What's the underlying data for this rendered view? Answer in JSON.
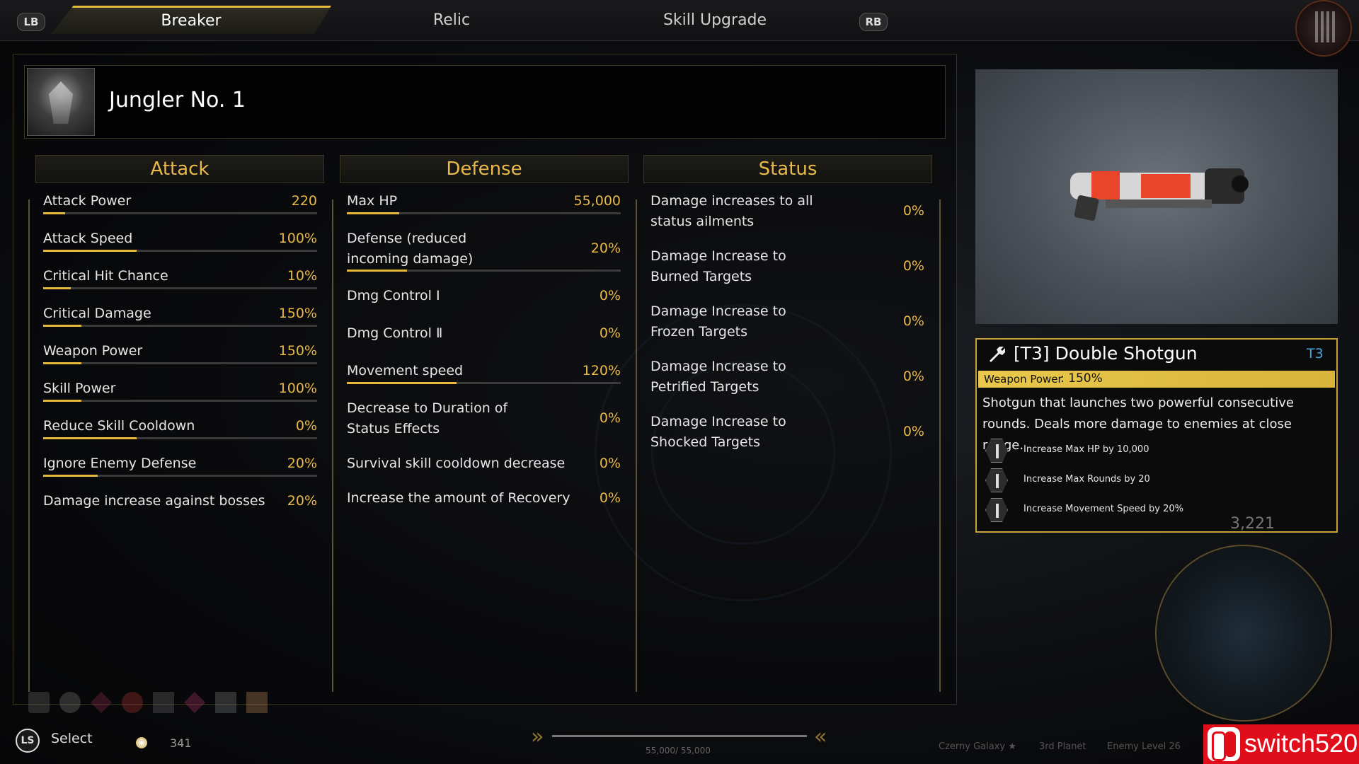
{
  "topbar": {
    "lb": "LB",
    "rb": "RB",
    "tabs": [
      {
        "label": "Breaker"
      },
      {
        "label": "Relic"
      },
      {
        "label": "Skill Upgrade"
      }
    ]
  },
  "character": {
    "name": "Jungler No. 1"
  },
  "columns": {
    "attack": {
      "title": "Attack",
      "stats": [
        {
          "label": "Attack Power",
          "value": "220",
          "bar": 0.08
        },
        {
          "label": "Attack Speed",
          "value": "100%",
          "bar": 0.34
        },
        {
          "label": "Critical Hit Chance",
          "value": "10%",
          "bar": 0.1
        },
        {
          "label": "Critical Damage",
          "value": "150%",
          "bar": 0.14
        },
        {
          "label": "Weapon Power",
          "value": "150%",
          "bar": 0.14
        },
        {
          "label": "Skill Power",
          "value": "100%",
          "bar": 0.14
        },
        {
          "label": "Reduce Skill Cooldown",
          "value": "0%",
          "bar": 0.34
        },
        {
          "label": "Ignore Enemy Defense",
          "value": "20%",
          "bar": 0.2
        },
        {
          "label": "Damage increase against bosses",
          "value": "20%",
          "bar": 0
        }
      ]
    },
    "defense": {
      "title": "Defense",
      "stats": [
        {
          "label": "Max HP",
          "value": "55,000",
          "bar": 0.19
        },
        {
          "label": "Defense (reduced incoming damage)",
          "value": "20%",
          "bar": 0.22
        },
        {
          "label": "Dmg Control Ⅰ",
          "value": "0%",
          "bar": 0
        },
        {
          "label": "Dmg Control Ⅱ",
          "value": "0%",
          "bar": 0
        },
        {
          "label": "Movement speed",
          "value": "120%",
          "bar": 0.4
        },
        {
          "label": "Decrease to Duration of Status Effects",
          "value": "0%",
          "bar": 0
        },
        {
          "label": "Survival skill cooldown decrease",
          "value": "0%",
          "bar": 0
        },
        {
          "label": "Increase the amount of Recovery",
          "value": "0%",
          "bar": 0
        }
      ]
    },
    "status": {
      "title": "Status",
      "stats": [
        {
          "label": "Damage increases to all status ailments",
          "value": "0%"
        },
        {
          "label": "Damage Increase to Burned Targets",
          "value": "0%"
        },
        {
          "label": "Damage Increase to Frozen Targets",
          "value": "0%"
        },
        {
          "label": "Damage Increase to Petrified Targets",
          "value": "0%"
        },
        {
          "label": "Damage Increase to Shocked Targets",
          "value": "0%"
        }
      ]
    }
  },
  "weapon": {
    "title": "[T3] Double Shotgun",
    "tier": "T3",
    "banner_label": "Weapon Power",
    "banner_value": ": 150%",
    "description": "Shotgun that launches two powerful consecutive rounds. Deals more damage to enemies at close range.",
    "perks": [
      "Increase Max HP by 10,000",
      "Increase Max Rounds by 20",
      "Increase Movement Speed by 20%"
    ],
    "colors": {
      "accent": "#e9b949",
      "tier": "#4aa6e0",
      "gun_red": "#e8452a"
    }
  },
  "bottom": {
    "ls": "LS",
    "select": "Select",
    "coins": "341",
    "hp": "55,000/ 55,000",
    "loc1": "Czerny Galaxy ★",
    "loc2": "3rd Planet",
    "loc3": "Enemy Level 26",
    "ghost": "3,221"
  },
  "watermark": "switch520"
}
